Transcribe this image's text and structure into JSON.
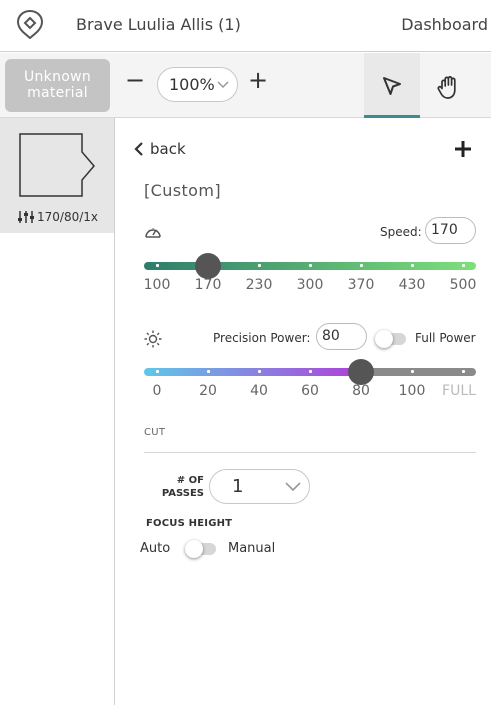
{
  "header": {
    "title": "Brave Luulia Allis (1)",
    "dashboard_label": "Dashboard"
  },
  "toolbar": {
    "material_label": "Unknown material",
    "zoom_minus": "−",
    "zoom_value": "100%",
    "zoom_plus": "+"
  },
  "layers": {
    "meta": "170/80/1x"
  },
  "settings": {
    "back_label": "back",
    "add_label": "+",
    "preset_name": "[Custom]",
    "speed": {
      "label": "Speed:",
      "value": "170",
      "ticks": [
        "100",
        "170",
        "230",
        "300",
        "370",
        "430",
        "500"
      ],
      "min": 100,
      "max": 500,
      "current": 170
    },
    "power": {
      "label": "Precision Power:",
      "value": "80",
      "ticks": [
        "0",
        "20",
        "40",
        "60",
        "80",
        "100",
        "FULL"
      ],
      "current": 80,
      "full_power_label": "Full Power",
      "full_power_on": false
    },
    "cut_label": "CUT",
    "passes": {
      "label_line1": "# OF",
      "label_line2": "PASSES",
      "value": "1"
    },
    "focus": {
      "label": "FOCUS HEIGHT",
      "auto_label": "Auto",
      "manual_label": "Manual",
      "manual_on": false
    }
  },
  "colors": {
    "speed_start": "#2e7d6b",
    "speed_end": "#7ee07a",
    "power_start": "#5fc8e8",
    "power_end": "#b040d8",
    "power_rest": "#8a8a8a",
    "knob": "#555555",
    "accent_underline": "#3d8a93",
    "material_button": "#c4c4c4"
  }
}
